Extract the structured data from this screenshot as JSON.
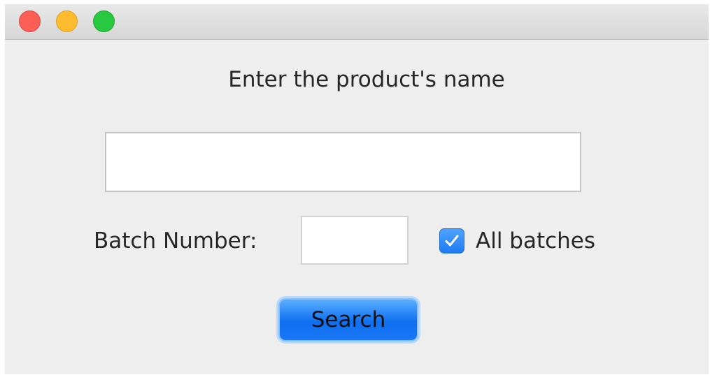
{
  "window": {
    "controls": {
      "close_color": "#fd5f57",
      "minimize_color": "#febc2e",
      "zoom_color": "#28c840"
    }
  },
  "form": {
    "prompt": "Enter the product's name",
    "product_name": {
      "value": ""
    },
    "batch": {
      "label": "Batch Number:",
      "value": ""
    },
    "all_batches": {
      "label": "All batches",
      "checked": true
    },
    "search_label": "Search"
  },
  "colors": {
    "accent": "#1f7bf2",
    "background": "#eeeeee"
  }
}
